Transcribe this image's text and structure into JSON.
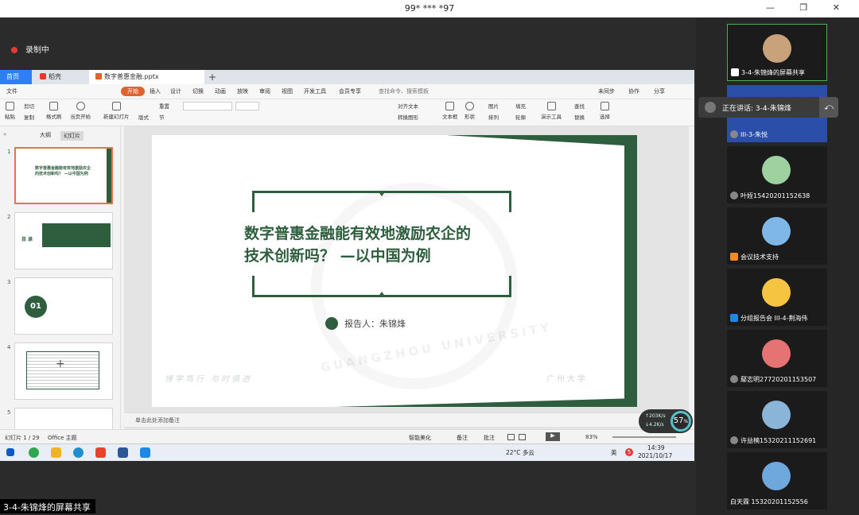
{
  "window": {
    "title": "99* *** *97",
    "controls": "— ❐ ✕"
  },
  "recording": {
    "label": "录制中"
  },
  "wps": {
    "tabs": {
      "home": "首页",
      "docer": "稻壳",
      "doc": "数字普惠金融.pptx",
      "add": "+"
    },
    "menu": [
      "文件",
      "开始",
      "插入",
      "设计",
      "切换",
      "动画",
      "放映",
      "审阅",
      "视图",
      "开发工具",
      "会员专享"
    ],
    "menu_active": "开始",
    "search": "查找命令、搜索模板",
    "right_actions": [
      "未同步",
      "协作",
      "分享"
    ],
    "ribbon": [
      "粘贴",
      "剪切",
      "复制",
      "格式刷",
      "当页开始",
      "新建幻灯片",
      "版式",
      "节",
      "重置",
      "对齐文本",
      "转换图形",
      "文本框",
      "形状",
      "图片",
      "排列",
      "填充",
      "轮廓",
      "演示工具",
      "查找",
      "替换",
      "选择"
    ],
    "panel_tabs": {
      "outline": "大纲",
      "slides": "幻灯片"
    },
    "thumbs": [
      {
        "num": "1",
        "text": "数字普惠金融能有效地激励农企的技术创新吗？ —以中国为例"
      },
      {
        "num": "2",
        "text": "目 录"
      },
      {
        "num": "3",
        "text": "01"
      },
      {
        "num": "4",
        "text": ""
      },
      {
        "num": "5",
        "text": ""
      }
    ],
    "add_slide": "+",
    "slide": {
      "title_line1": "数字普惠金融能有效地激励农企的",
      "title_line2": "技术创新吗？ —以中国为例",
      "reporter": "报告人：朱锦烽",
      "motto": "博学笃行 与时俱进",
      "university": "广州大学",
      "watermark": "GUANGZHOU UNIVERSITY"
    },
    "notes": "单击此处添加备注",
    "status": {
      "slide_count": "幻灯片 1 / 29",
      "theme": "Office 主题",
      "beautify": "智能美化",
      "notes": "备注",
      "comments": "批注",
      "zoom": "83%"
    }
  },
  "speed": {
    "up": "203",
    "down": "4.2",
    "unit": "K/s",
    "percent": "57"
  },
  "taskbar": {
    "weather": "22°C 多云",
    "time": "14:39",
    "date": "2021/10/17",
    "ime": "英",
    "notify": "5"
  },
  "share_label": "3-4-朱锦烽的屏幕共享",
  "speaking": {
    "text": "正在讲话: 3-4-朱锦烽"
  },
  "participants": [
    {
      "name": "3-4-朱锦烽的屏幕共享",
      "color": "#2d2d2d",
      "face": "#c8a27a"
    },
    {
      "name": "III-3-朱悦",
      "color": "#2b4fa8",
      "face": ""
    },
    {
      "name": "叶姪15420201152638",
      "color": "#1b1b1b",
      "face": "#9fd0a0"
    },
    {
      "name": "会议技术支持",
      "color": "#1b1b1b",
      "face": "#7fb8e8"
    },
    {
      "name": "分组报告会 III-4-荆海伟",
      "color": "#1b1b1b",
      "face": "#f5c542"
    },
    {
      "name": "鄢志明27720201153507",
      "color": "#1b1b1b",
      "face": "#e57373"
    },
    {
      "name": "许益楠15320211152691",
      "color": "#1b1b1b",
      "face": "#8ab4d8"
    },
    {
      "name": "白天霖 15320201152556",
      "color": "#1b1b1b",
      "face": "#6fa8dc"
    }
  ]
}
